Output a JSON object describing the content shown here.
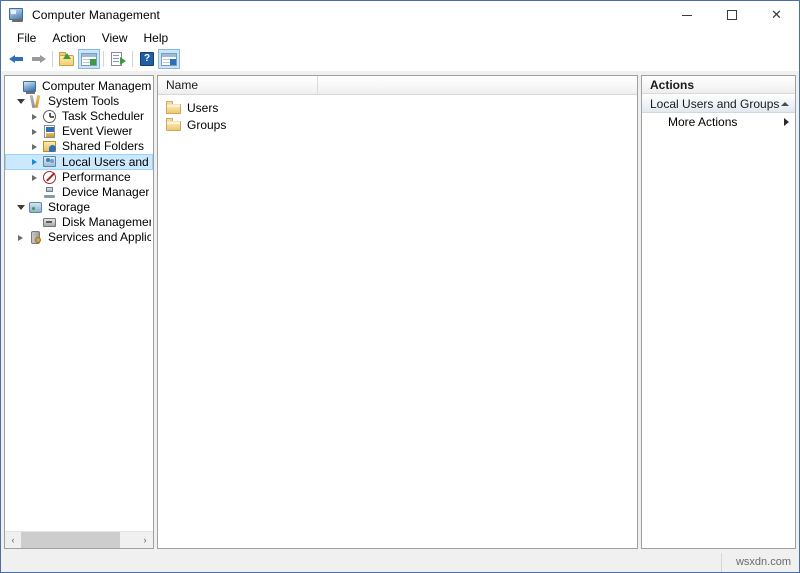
{
  "window": {
    "title": "Computer Management",
    "icon": "mmc-console-icon",
    "controls": {
      "minimize": "–",
      "maximize": "□",
      "close": "✕"
    }
  },
  "menubar": {
    "items": [
      {
        "label": "File"
      },
      {
        "label": "Action"
      },
      {
        "label": "View"
      },
      {
        "label": "Help"
      }
    ]
  },
  "toolbar": {
    "buttons": [
      {
        "name": "back-button",
        "icon": "back-arrow-icon",
        "enabled": true
      },
      {
        "name": "forward-button",
        "icon": "forward-arrow-icon",
        "enabled": false
      },
      {
        "name": "up-one-level-button",
        "icon": "folder-up-icon"
      },
      {
        "name": "show-hide-console-tree-button",
        "icon": "console-tree-icon",
        "pressed": true
      },
      {
        "name": "export-list-button",
        "icon": "export-list-icon"
      },
      {
        "name": "help-button",
        "icon": "help-question-icon"
      },
      {
        "name": "show-hide-action-pane-button",
        "icon": "action-pane-icon",
        "pressed": true
      }
    ]
  },
  "tree": {
    "items": [
      {
        "label": "Computer Management (Local",
        "icon": "mmc-console-icon",
        "indent": 0,
        "expander": "none",
        "selected": false
      },
      {
        "label": "System Tools",
        "icon": "system-tools-icon",
        "indent": 1,
        "expander": "open",
        "selected": false
      },
      {
        "label": "Task Scheduler",
        "icon": "clock-icon",
        "indent": 2,
        "expander": "closed",
        "selected": false
      },
      {
        "label": "Event Viewer",
        "icon": "event-log-icon",
        "indent": 2,
        "expander": "closed",
        "selected": false
      },
      {
        "label": "Shared Folders",
        "icon": "shared-folder-icon",
        "indent": 2,
        "expander": "closed",
        "selected": false
      },
      {
        "label": "Local Users and Groups",
        "icon": "users-groups-icon",
        "indent": 2,
        "expander": "closed",
        "selected": true
      },
      {
        "label": "Performance",
        "icon": "performance-icon",
        "indent": 2,
        "expander": "closed",
        "selected": false
      },
      {
        "label": "Device Manager",
        "icon": "device-manager-icon",
        "indent": 2,
        "expander": "none",
        "selected": false
      },
      {
        "label": "Storage",
        "icon": "storage-icon",
        "indent": 1,
        "expander": "open",
        "selected": false
      },
      {
        "label": "Disk Management",
        "icon": "disk-icon",
        "indent": 2,
        "expander": "none",
        "selected": false
      },
      {
        "label": "Services and Applications",
        "icon": "services-icon",
        "indent": 1,
        "expander": "closed",
        "selected": false
      }
    ],
    "scrollbar": {
      "left_arrow": "‹",
      "right_arrow": "›"
    }
  },
  "list": {
    "columns": [
      {
        "label": "Name"
      }
    ],
    "rows": [
      {
        "name": "Users",
        "icon": "folder-icon"
      },
      {
        "name": "Groups",
        "icon": "folder-icon"
      }
    ]
  },
  "actions": {
    "title": "Actions",
    "groups": [
      {
        "label": "Local Users and Groups",
        "collapse_icon": "caret-up-icon",
        "items": [
          {
            "label": "More Actions",
            "submenu_icon": "caret-right-icon"
          }
        ]
      }
    ]
  },
  "statusbar": {
    "watermark": "wsxdn.com"
  },
  "colors": {
    "selection": "#cce8ff",
    "window_border": "#4a6fa5",
    "chrome": "#f0f0f0"
  }
}
